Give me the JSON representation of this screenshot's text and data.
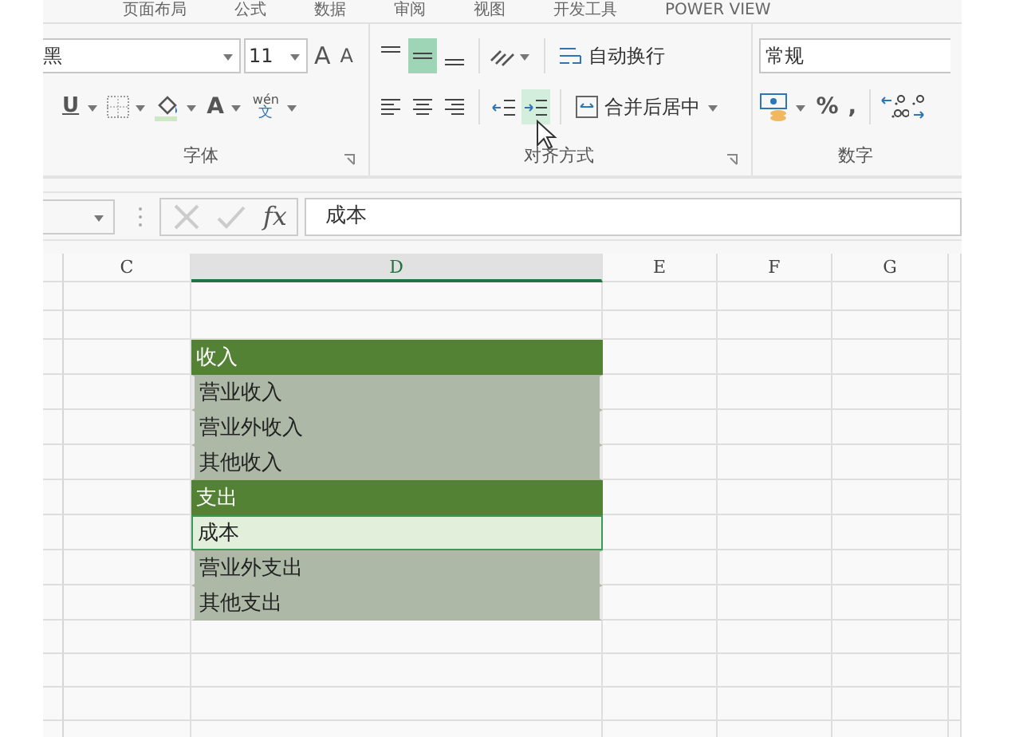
{
  "ribbon_tabs": [
    "页面布局",
    "公式",
    "数据",
    "审阅",
    "视图",
    "开发工具",
    "POWER VIEW"
  ],
  "font_group": {
    "label": "字体",
    "font_name": "黑",
    "font_size": "11",
    "grow_font": "A",
    "shrink_font": "A",
    "underline": "U",
    "font_color": "A",
    "phonetic_top": "wén",
    "phonetic_bottom": "文"
  },
  "alignment_group": {
    "label": "对齐方式",
    "vertical_align": [
      {
        "kind": "top",
        "selected": false
      },
      {
        "kind": "middle",
        "selected": true
      },
      {
        "kind": "bottom",
        "selected": false
      }
    ],
    "horizontal_align": [
      {
        "kind": "left",
        "selected": false
      },
      {
        "kind": "center",
        "selected": false
      },
      {
        "kind": "right",
        "selected": false
      }
    ],
    "indent": [
      {
        "kind": "decrease",
        "selected": false
      },
      {
        "kind": "increase",
        "selected": true
      }
    ],
    "wrap_text": "自动换行",
    "merge_center": "合并后居中"
  },
  "number_group": {
    "label": "数字",
    "format": "常规",
    "percent": "%",
    "comma": ","
  },
  "formula_bar": {
    "fx": "fx",
    "value": "成本"
  },
  "columns": [
    {
      "label": "C",
      "selected": false
    },
    {
      "label": "D",
      "selected": true
    },
    {
      "label": "E",
      "selected": false
    },
    {
      "label": "F",
      "selected": false
    },
    {
      "label": "G",
      "selected": false
    }
  ],
  "rows": [
    {
      "kind": "blank"
    },
    {
      "kind": "blank"
    },
    {
      "kind": "header",
      "text": "收入",
      "selected": false
    },
    {
      "kind": "item",
      "text": "营业收入",
      "selected": false
    },
    {
      "kind": "item",
      "text": "营业外收入",
      "selected": false
    },
    {
      "kind": "item",
      "text": "其他收入",
      "selected": false
    },
    {
      "kind": "header",
      "text": "支出",
      "selected": false
    },
    {
      "kind": "item",
      "text": "成本",
      "selected": true
    },
    {
      "kind": "item",
      "text": "营业外支出",
      "selected": false
    },
    {
      "kind": "item",
      "text": "其他支出",
      "selected": false
    },
    {
      "kind": "blank"
    },
    {
      "kind": "blank"
    },
    {
      "kind": "blank"
    },
    {
      "kind": "blank"
    }
  ]
}
